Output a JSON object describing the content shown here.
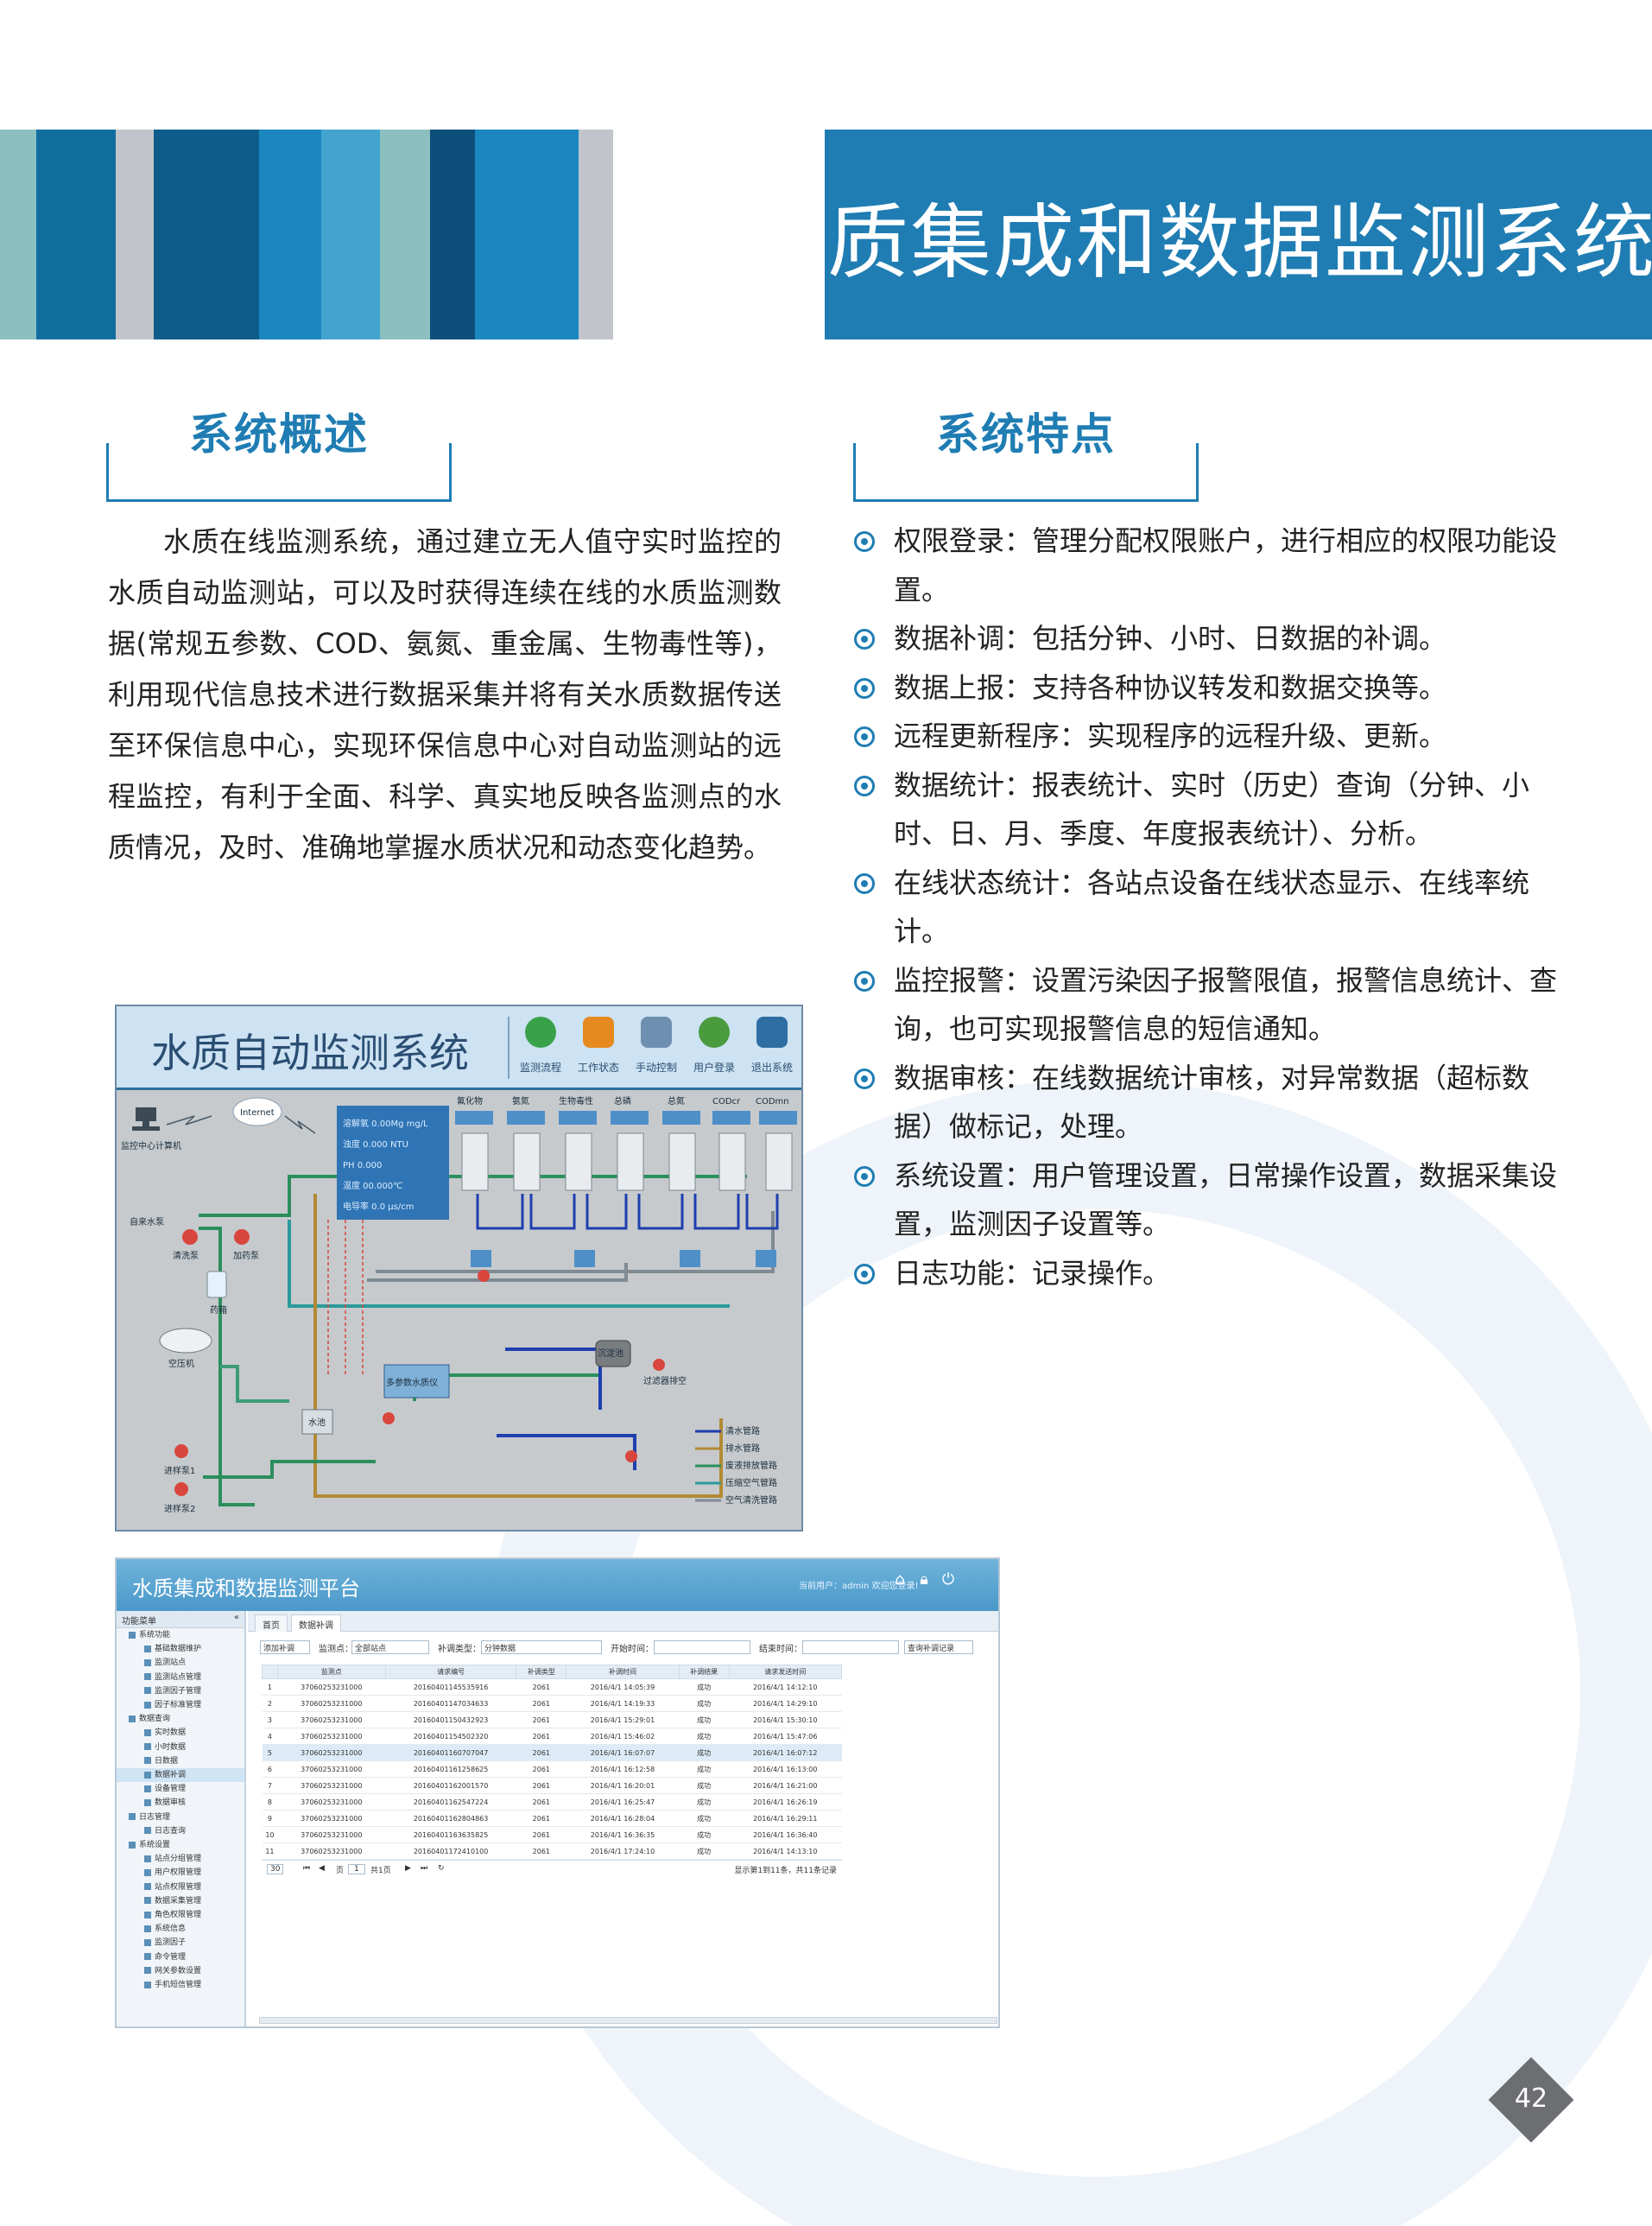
{
  "page": {
    "title": "水质集成和数据监测系统",
    "page_number": "42"
  },
  "colors": {
    "accent": "#1f7db3",
    "stripes": [
      "#8bbfc0",
      "#136ea0",
      "#c1c5cb",
      "#0e5c8a",
      "#1b86bf",
      "#44a4cf",
      "#8bbfc0",
      "#0d4f7a",
      "#1b86bf",
      "#c1c5cb"
    ]
  },
  "overview": {
    "heading": "系统概述",
    "text": "水质在线监测系统，通过建立无人值守实时监控的水质自动监测站，可以及时获得连续在线的水质监测数据(常规五参数、COD、氨氮、重金属、生物毒性等)，利用现代信息技术进行数据采集并将有关水质数据传送至环保信息中心，实现环保信息中心对自动监测站的远程监控，有利于全面、科学、真实地反映各监测点的水质情况，及时、准确地掌握水质状况和动态变化趋势。"
  },
  "features": {
    "heading": "系统特点",
    "items": [
      "权限登录：管理分配权限账户，进行相应的权限功能设置。",
      "数据补调：包括分钟、小时、日数据的补调。",
      "数据上报：支持各种协议转发和数据交换等。",
      "远程更新程序：实现程序的远程升级、更新。",
      "数据统计：报表统计、实时（历史）查询（分钟、小时、日、月、季度、年度报表统计）、分析。",
      "在线状态统计：各站点设备在线状态显示、在线率统计。",
      "监控报警：设置污染因子报警限值，报警信息统计、查询，也可实现报警信息的短信通知。",
      "数据审核：在线数据统计审核，对异常数据（超标数据）做标记，处理。",
      "系统设置：用户管理设置，日常操作设置，数据采集设置，监测因子设置等。",
      "日志功能：记录操作。"
    ]
  },
  "screenshot1": {
    "title": "水质自动监测系统",
    "toolbar": [
      {
        "label": "监测流程",
        "icon": "globe-icon",
        "color": "#3aa14b"
      },
      {
        "label": "工作状态",
        "icon": "document-icon",
        "color": "#e68a1f"
      },
      {
        "label": "手动控制",
        "icon": "tools-icon",
        "color": "#6f8fb0"
      },
      {
        "label": "用户登录",
        "icon": "users-icon",
        "color": "#4a9a3e"
      },
      {
        "label": "退出系统",
        "icon": "exit-icon",
        "color": "#2f6ea3"
      }
    ],
    "labels": {
      "internet": "Internet",
      "center": "监控中心计算机",
      "tap_water": "自来水泵",
      "clean_pump": "清洗泵",
      "dose_pump": "加药泵",
      "reagent": "药箱",
      "compressor": "空压机",
      "inlet1": "进样泵1",
      "inlet2": "进样泵2",
      "tank": "水池",
      "sampler": "多参数水质仪",
      "settle": "沉淀池",
      "filter_pump": "过滤器排空"
    },
    "readings": [
      "溶解氧  0.00Mg  mg/L",
      "浊度   0.000  NTU",
      "PH    0.000",
      "温度   00.000℃",
      "电导率  0.0  μs/cm"
    ],
    "analyzers": [
      "氟化物",
      "氨氮",
      "生物毒性",
      "总磷",
      "总氮",
      "CODcr",
      "CODmn"
    ],
    "legend": [
      "清水管路",
      "排水管路",
      "废液排放管路",
      "压缩空气管路",
      "空气清洗管路"
    ]
  },
  "screenshot2": {
    "title": "水质集成和数据监测平台",
    "user_text": "当前用户：admin 欢迎您登录!",
    "sidebar_header": "功能菜单",
    "sidebar": [
      {
        "label": "系统功能",
        "level": 1
      },
      {
        "label": "基础数据维护",
        "level": 2
      },
      {
        "label": "监测站点",
        "level": 2
      },
      {
        "label": "监测站点管理",
        "level": 2
      },
      {
        "label": "监测因子管理",
        "level": 2
      },
      {
        "label": "因子标准管理",
        "level": 2
      },
      {
        "label": "数据查询",
        "level": 1
      },
      {
        "label": "实时数据",
        "level": 2
      },
      {
        "label": "小时数据",
        "level": 2
      },
      {
        "label": "日数据",
        "level": 2
      },
      {
        "label": "数据补调",
        "level": 2
      },
      {
        "label": "设备管理",
        "level": 2
      },
      {
        "label": "数据审核",
        "level": 2
      },
      {
        "label": "日志管理",
        "level": 1
      },
      {
        "label": "日志查询",
        "level": 2
      },
      {
        "label": "系统设置",
        "level": 1
      },
      {
        "label": "站点分组管理",
        "level": 2
      },
      {
        "label": "用户权限管理",
        "level": 2
      },
      {
        "label": "站点权限管理",
        "level": 2
      },
      {
        "label": "数据采集管理",
        "level": 2
      },
      {
        "label": "角色权限管理",
        "level": 2
      },
      {
        "label": "系统信息",
        "level": 2
      },
      {
        "label": "监测因子",
        "level": 2
      },
      {
        "label": "命令管理",
        "level": 2
      },
      {
        "label": "网关参数设置",
        "level": 2
      },
      {
        "label": "手机短信管理",
        "level": 2
      }
    ],
    "tabs": [
      "首页",
      "数据补调"
    ],
    "filters": {
      "add": "添加补调",
      "station_label": "监测点：",
      "station_value": "全部站点",
      "type_label": "补调类型：",
      "type_value": "分钟数据",
      "start_label": "开始时间：",
      "end_label": "结束时间：",
      "query": "查询补调记录"
    },
    "columns": [
      "",
      "监测点",
      "请求编号",
      "补调类型",
      "补调时间",
      "补调结果",
      "请求发送时间"
    ],
    "rows": [
      [
        "1",
        "37060253231000",
        "20160401145535916",
        "2061",
        "2016/4/1 14:05:39",
        "成功",
        "2016/4/1 14:12:10"
      ],
      [
        "2",
        "37060253231000",
        "20160401147034633",
        "2061",
        "2016/4/1 14:19:33",
        "成功",
        "2016/4/1 14:29:10"
      ],
      [
        "3",
        "37060253231000",
        "20160401150432923",
        "2061",
        "2016/4/1 15:29:01",
        "成功",
        "2016/4/1 15:30:10"
      ],
      [
        "4",
        "37060253231000",
        "20160401154502320",
        "2061",
        "2016/4/1 15:46:02",
        "成功",
        "2016/4/1 15:47:06"
      ],
      [
        "5",
        "37060253231000",
        "20160401160707047",
        "2061",
        "2016/4/1 16:07:07",
        "成功",
        "2016/4/1 16:07:12"
      ],
      [
        "6",
        "37060253231000",
        "20160401161258625",
        "2061",
        "2016/4/1 16:12:58",
        "成功",
        "2016/4/1 16:13:00"
      ],
      [
        "7",
        "37060253231000",
        "20160401162001570",
        "2061",
        "2016/4/1 16:20:01",
        "成功",
        "2016/4/1 16:21:00"
      ],
      [
        "8",
        "37060253231000",
        "20160401162547224",
        "2061",
        "2016/4/1 16:25:47",
        "成功",
        "2016/4/1 16:26:19"
      ],
      [
        "9",
        "37060253231000",
        "20160401162804863",
        "2061",
        "2016/4/1 16:28:04",
        "成功",
        "2016/4/1 16:29:11"
      ],
      [
        "10",
        "37060253231000",
        "20160401163635825",
        "2061",
        "2016/4/1 16:36:35",
        "成功",
        "2016/4/1 16:36:40"
      ],
      [
        "11",
        "37060253231000",
        "20160401172410100",
        "2061",
        "2016/4/1 17:24:10",
        "成功",
        "2016/4/1 14:13:10"
      ]
    ],
    "highlight_row": 4,
    "pager": {
      "page_size": "30",
      "page_label": "页",
      "page_value": "1",
      "of_pages": "共1页",
      "summary": "显示第1到11条，共11条记录"
    }
  }
}
